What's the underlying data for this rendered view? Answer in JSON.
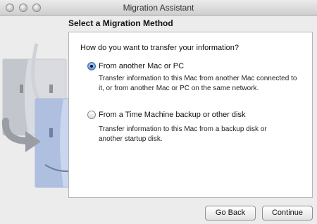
{
  "window": {
    "title": "Migration Assistant"
  },
  "page": {
    "heading": "Select a Migration Method"
  },
  "panel": {
    "question": "How do you want to transfer your information?",
    "options": [
      {
        "label": "From another Mac or PC",
        "description": "Transfer information to this Mac from another Mac connected to it, or from another Mac or PC on the same network.",
        "selected": true
      },
      {
        "label": "From a Time Machine backup or other disk",
        "description": "Transfer information to this Mac from a backup disk or another startup disk.",
        "selected": false
      }
    ]
  },
  "buttons": {
    "back": "Go Back",
    "continue": "Continue"
  },
  "icons": {
    "art": "migration-finder-icon",
    "arrow": "transfer-arrow-icon"
  },
  "colors": {
    "accent": "#3d78c9",
    "window_bg": "#ececec",
    "panel_bg": "#ffffff"
  }
}
